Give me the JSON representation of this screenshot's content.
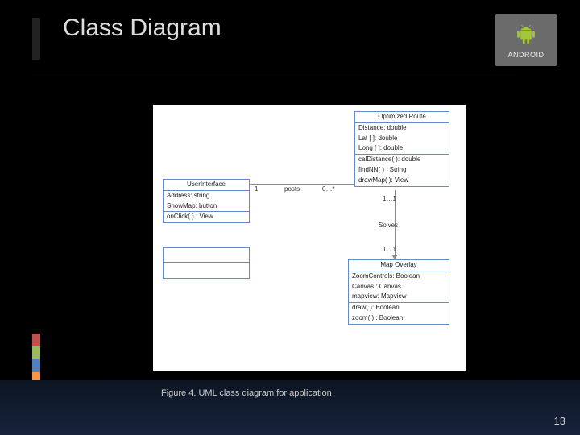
{
  "slide": {
    "title": "Class Diagram",
    "caption": "Figure 4. UML class diagram for application",
    "page": "13",
    "logo_text": "ANDROID"
  },
  "uml": {
    "user_interface": {
      "name": "UserInterface",
      "attrs": [
        "Address: string",
        "ShowMap: button"
      ],
      "ops": [
        "onClick( ) : View"
      ]
    },
    "optimized_route": {
      "name": "Optimized Route",
      "attrs": [
        "Distance: double",
        "Lat [ ]: double",
        "Long [ ]: double"
      ],
      "ops": [
        "calDistance( ): double",
        "findNN( ) : String",
        "drawMap( ): View"
      ]
    },
    "map_overlay": {
      "name": "Map Overlay",
      "attrs": [
        "ZoomControls: Boolean",
        "Canvas : Canvas",
        "mapview: Mapview"
      ],
      "ops": [
        "draw( ): Boolean",
        "zoom( ) : Boolean"
      ]
    },
    "rel": {
      "posts_label": "posts",
      "posts_left_mult": "1",
      "posts_right_mult": "0…*",
      "solves_label": "Solves",
      "solves_top_mult": "1…1",
      "solves_bottom_mult": "1…1"
    }
  }
}
